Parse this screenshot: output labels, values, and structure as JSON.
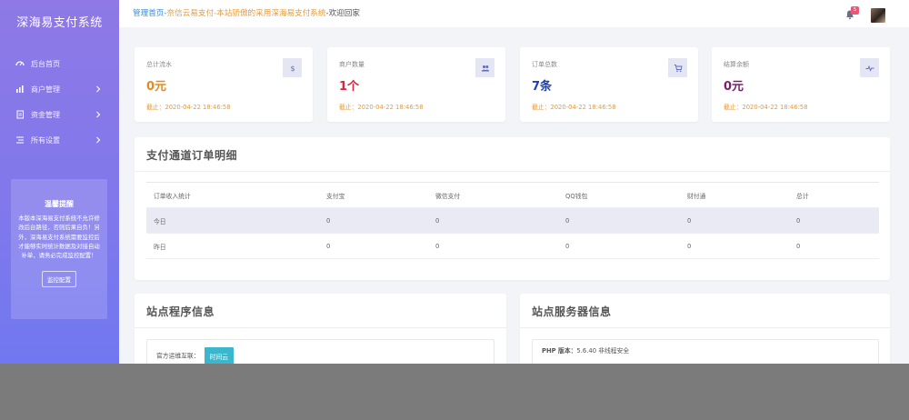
{
  "sidebar": {
    "brand": "深海易支付系统",
    "items": [
      {
        "label": "后台首页",
        "icon": "dashboard-icon"
      },
      {
        "label": "商户管理",
        "icon": "bar-chart-icon"
      },
      {
        "label": "资金管理",
        "icon": "document-icon"
      },
      {
        "label": "所有设置",
        "icon": "list-settings-icon"
      }
    ],
    "notice": {
      "title": "温馨提醒",
      "text": "本版本深海易支付系统不允许修改后台路径，否则后果自负！另外，深海易支付系统需要监控后才能够实时统计数据及对接自动补单，请务必完成监控配置！",
      "button": "监控配置"
    }
  },
  "topbar": {
    "crumb_home": "管理首页",
    "crumb_sep": "-",
    "crumb_site": "奈信云易支付-本站骄傲的采用深海易支付系统",
    "crumb_welcome": "-欢迎回家",
    "notification_count": "5"
  },
  "stats": [
    {
      "label": "总计流水",
      "value": "0元",
      "time": "截止：2020-04-22 18:46:58",
      "color": "#e68a1f",
      "icon": "dollar-icon"
    },
    {
      "label": "商户数量",
      "value": "1个",
      "time": "截止：2020-04-22 18:46:58",
      "color": "#d7263d",
      "icon": "users-icon"
    },
    {
      "label": "订单总数",
      "value": "7条",
      "time": "截止：2020-04-22 18:46:58",
      "color": "#1f3fb8",
      "icon": "cart-icon"
    },
    {
      "label": "结算余额",
      "value": "0元",
      "time": "截止：2020-04-22 18:46:58",
      "color": "#7b1f6a",
      "icon": "pulse-icon"
    }
  ],
  "orders": {
    "title": "支付通道订单明细",
    "headers": [
      "订单收入统计",
      "支付宝",
      "微信支付",
      "QQ钱包",
      "财付通",
      "总计"
    ],
    "rows": [
      [
        "今日",
        "0",
        "0",
        "0",
        "0",
        "0"
      ],
      [
        "昨日",
        "0",
        "0",
        "0",
        "0",
        "0"
      ]
    ]
  },
  "program": {
    "title": "站点程序信息",
    "label": "官方运维互联：",
    "button": "时间云"
  },
  "server": {
    "title": "站点服务器信息",
    "php_label": "PHP 版本：",
    "php_value": "5.6.40 非线程安全"
  }
}
